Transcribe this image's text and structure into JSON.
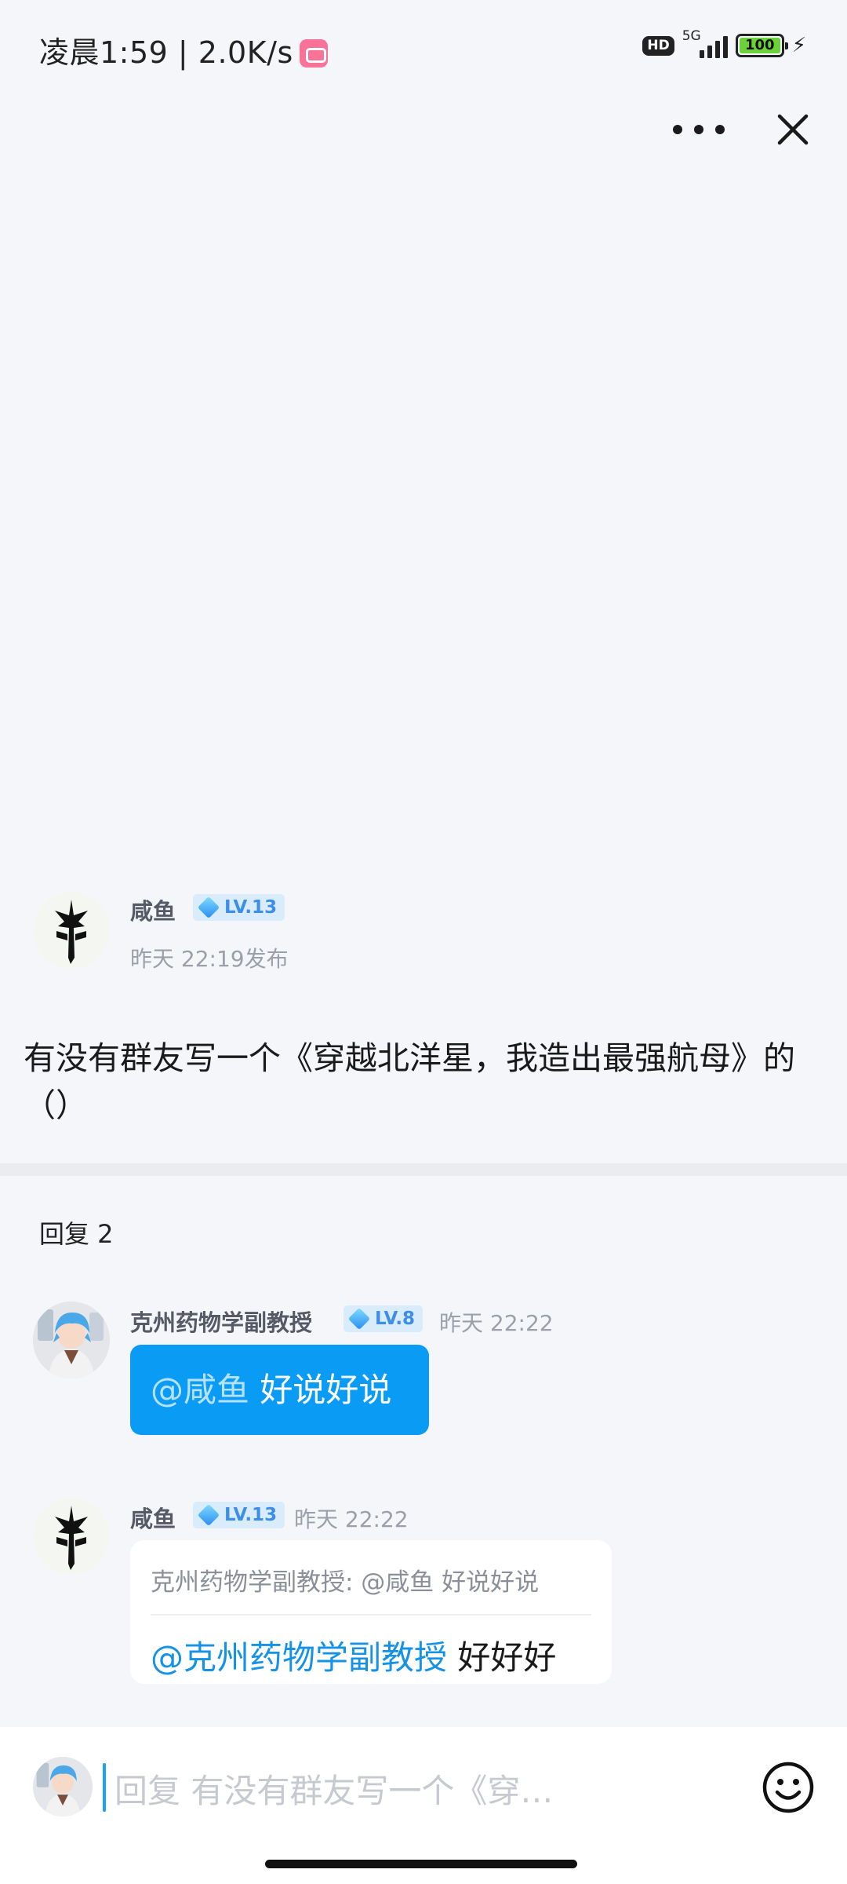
{
  "status_bar": {
    "time_speed": "凌晨1:59 | 2.0K/s",
    "hd": "HD",
    "network": "5G",
    "battery": "100"
  },
  "post": {
    "author": "咸鱼",
    "level": "LV.13",
    "time": "昨天 22:19发布",
    "text": "有没有群友写一个《穿越北洋星，我造出最强航母》的（）"
  },
  "replies": {
    "header": "回复 2",
    "items": [
      {
        "author": "克州药物学副教授",
        "level": "LV.8",
        "time": "昨天 22:22",
        "mention": "@咸鱼",
        "text": " 好说好说"
      },
      {
        "author": "咸鱼",
        "level": "LV.13",
        "time": "昨天 22:22",
        "quote": "克州药物学副教授: @咸鱼 好说好说",
        "mention": "@克州药物学副教授",
        "text": " 好好好"
      }
    ]
  },
  "composer": {
    "placeholder": "回复 有没有群友写一个《穿…"
  },
  "colors": {
    "accent": "#0a9cf5",
    "mention": "#1592e6",
    "level_badge_bg": "#d8ecfc"
  },
  "icons": [
    "more-icon",
    "close-icon",
    "emoji-icon",
    "diamond-level-icon"
  ]
}
